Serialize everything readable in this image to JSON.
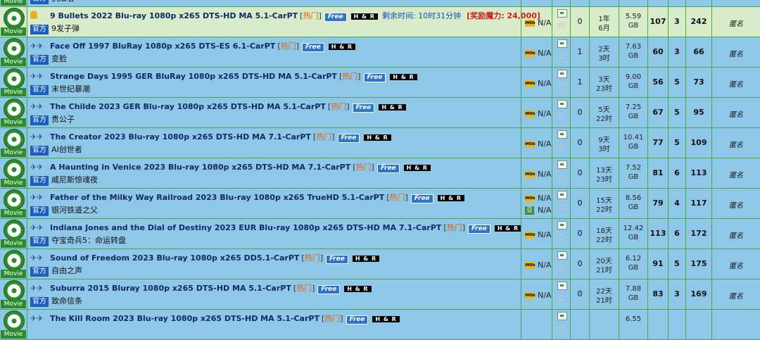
{
  "category_label": "Movie",
  "official_badge": "官方",
  "free_badge": "Free",
  "hr_badge": "H & R",
  "hot_tag": "热门",
  "rating_na": "N/A",
  "imdb_icon": "imdb-icon",
  "douban_label": "豆",
  "uploader_anon": "匿名",
  "colors": {
    "row_bg": "#8fc7e8",
    "sticky_bg": "#d8ecc9",
    "grid": "#4aa64a",
    "hot": "#e0620c",
    "free_bg": "#2e74c9",
    "bonus": "#d11e1e"
  },
  "torrents": [
    {
      "title": "",
      "subtitle": "执法者",
      "hot": false,
      "free": false,
      "hr": false,
      "douban": false,
      "comments": "",
      "time1": "",
      "time2": "",
      "size": "",
      "unit": "",
      "seeders": "",
      "leechers": "",
      "completed": ""
    },
    {
      "title": "9 Bullets 2022 Blu-ray 1080p x265 DTS-HD MA 5.1-CarPT",
      "subtitle": "9发子弹",
      "hot": true,
      "free": true,
      "hr": true,
      "douban": false,
      "remaining": "剩余时间: 10时31分钟",
      "bonus": "[奖励魔力: 24,000]",
      "comments": "0",
      "time1": "1年",
      "time2": "6月",
      "size": "5.59",
      "unit": "GB",
      "seeders": "107",
      "leechers": "3",
      "completed": "242"
    },
    {
      "title": "Face Off 1997 BluRay 1080p x265 DTS-ES 6.1-CarPT",
      "subtitle": "变脸",
      "hot": true,
      "free": true,
      "hr": true,
      "douban": false,
      "comments": "1",
      "time1": "2天",
      "time2": "3时",
      "size": "7.63",
      "unit": "GB",
      "seeders": "60",
      "leechers": "3",
      "completed": "66"
    },
    {
      "title": "Strange Days 1995 GER BluRay 1080p x265 DTS-HD MA 5.1-CarPT",
      "subtitle": "末世纪暴潮",
      "hot": true,
      "free": true,
      "hr": true,
      "douban": false,
      "comments": "1",
      "time1": "3天",
      "time2": "23时",
      "size": "9.00",
      "unit": "GB",
      "seeders": "56",
      "leechers": "5",
      "completed": "73"
    },
    {
      "title": "The Childe 2023 GER Blu-ray 1080p x265 DTS-HD MA 5.1-CarPT",
      "subtitle": "贵公子",
      "hot": true,
      "free": true,
      "hr": true,
      "douban": false,
      "comments": "0",
      "time1": "5天",
      "time2": "22时",
      "size": "7.25",
      "unit": "GB",
      "seeders": "67",
      "leechers": "5",
      "completed": "95"
    },
    {
      "title": "The Creator 2023 Blu-ray 1080p x265 DTS-HD MA 7.1-CarPT",
      "subtitle": "AI创世者",
      "hot": true,
      "free": true,
      "hr": true,
      "douban": false,
      "comments": "0",
      "time1": "9天",
      "time2": "3时",
      "size": "10.41",
      "unit": "GB",
      "seeders": "77",
      "leechers": "5",
      "completed": "109"
    },
    {
      "title": "A Haunting in Venice 2023 Blu-ray 1080p x265 DTS-HD MA 7.1-CarPT",
      "subtitle": "威尼斯惊魂夜",
      "hot": true,
      "free": true,
      "hr": true,
      "douban": false,
      "comments": "0",
      "time1": "13天",
      "time2": "23时",
      "size": "7.52",
      "unit": "GB",
      "seeders": "81",
      "leechers": "6",
      "completed": "113"
    },
    {
      "title": "Father of the Milky Way Railroad 2023 Blu-ray 1080p x265 TrueHD 5.1-CarPT",
      "subtitle": "银河铁道之父",
      "hot": true,
      "free": true,
      "hr": true,
      "douban": true,
      "comments": "0",
      "time1": "15天",
      "time2": "22时",
      "size": "8.56",
      "unit": "GB",
      "seeders": "79",
      "leechers": "4",
      "completed": "117"
    },
    {
      "title": "Indiana Jones and the Dial of Destiny 2023 EUR Blu-ray 1080p x265 DTS-HD MA 7.1-CarPT",
      "subtitle": "夺宝奇兵5：命运转盘",
      "hot": true,
      "free": true,
      "hr": true,
      "douban": false,
      "comments": "0",
      "time1": "18天",
      "time2": "22时",
      "size": "12.42",
      "unit": "GB",
      "seeders": "113",
      "leechers": "6",
      "completed": "172"
    },
    {
      "title": "Sound of Freedom 2023 Blu-ray 1080p x265 DD5.1-CarPT",
      "subtitle": "自由之声",
      "hot": true,
      "free": true,
      "hr": true,
      "douban": false,
      "comments": "0",
      "time1": "20天",
      "time2": "21时",
      "size": "6.12",
      "unit": "GB",
      "seeders": "91",
      "leechers": "5",
      "completed": "175"
    },
    {
      "title": "Suburra 2015 Bluray 1080p x265 DTS-HD MA 5.1-CarPT",
      "subtitle": "致命信条",
      "hot": true,
      "free": true,
      "hr": true,
      "douban": false,
      "comments": "0",
      "time1": "22天",
      "time2": "21时",
      "size": "7.88",
      "unit": "GB",
      "seeders": "83",
      "leechers": "3",
      "completed": "169"
    },
    {
      "title": "The Kill Room 2023 Blu-ray 1080p x265 DTS-HD MA 5.1-CarPT",
      "subtitle": "",
      "hot": true,
      "free": true,
      "hr": true,
      "douban": false,
      "comments": "",
      "time1": "",
      "time2": "",
      "size": "6.55",
      "unit": "",
      "seeders": "",
      "leechers": "",
      "completed": ""
    }
  ]
}
